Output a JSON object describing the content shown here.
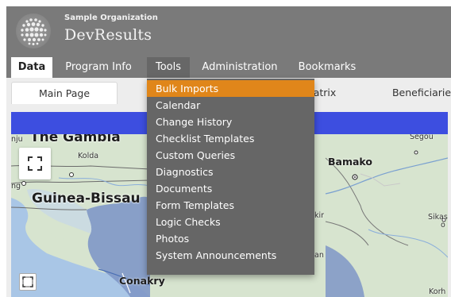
{
  "header": {
    "org_name": "Sample Organization",
    "app_name": "DevResults"
  },
  "main_nav": {
    "tabs": [
      {
        "label": "Data",
        "active": true
      },
      {
        "label": "Program Info"
      },
      {
        "label": "Tools",
        "open": true
      },
      {
        "label": "Administration"
      },
      {
        "label": "Bookmarks"
      }
    ]
  },
  "sub_nav": {
    "tabs": [
      {
        "label": "Main Page",
        "active": true
      },
      {
        "label": "atrix"
      },
      {
        "label": "Beneficiarie"
      }
    ]
  },
  "tools_menu": {
    "items": [
      {
        "label": "Bulk Imports",
        "highlighted": true
      },
      {
        "label": "Calendar"
      },
      {
        "label": "Change History"
      },
      {
        "label": "Checklist Templates"
      },
      {
        "label": "Custom Queries"
      },
      {
        "label": "Diagnostics"
      },
      {
        "label": "Documents"
      },
      {
        "label": "Form Templates"
      },
      {
        "label": "Logic Checks"
      },
      {
        "label": "Photos"
      },
      {
        "label": "System Announcements"
      }
    ]
  },
  "map": {
    "labels": {
      "gambia_prefix": "nju",
      "gambia": "The Gambia",
      "kolda": "Kolda",
      "ior": "ior",
      "ng": "ng",
      "guinea_bissau": "Guinea-Bissau",
      "bamako": "Bamako",
      "segou": "Segou",
      "sikas": "Sikas",
      "sikas_o": "o",
      "kir": "kir",
      "an": "an",
      "conakry": "Conakry",
      "korh": "Korh"
    },
    "icons": {
      "fullscreen": "fullscreen-icon",
      "extent": "extent-icon"
    }
  },
  "colors": {
    "header_bg": "#7a7a7a",
    "dropdown_bg": "#666666",
    "highlight": "#e0861a",
    "map_bar": "#3d4ee0"
  }
}
